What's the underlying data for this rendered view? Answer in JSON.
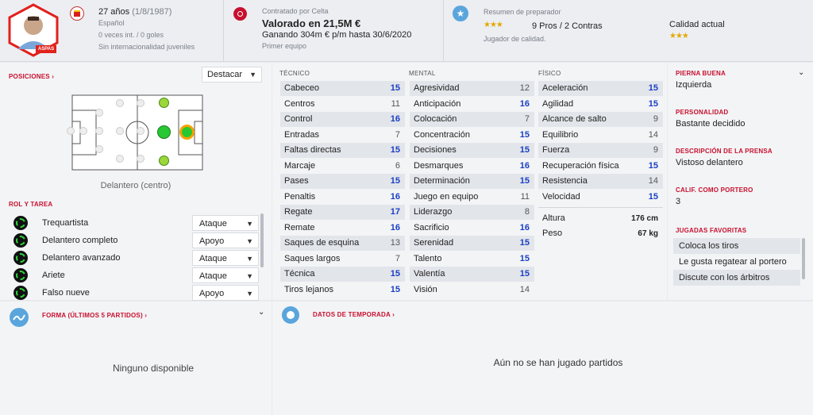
{
  "header": {
    "age": "27 años",
    "dob": "(1/8/1987)",
    "nationality": "Español",
    "caps": "0 veces int. / 0 goles",
    "youth_caps": "Sin internacionalidad juveniles",
    "player_tag": "ASPAS",
    "contract_label": "Contratado por Celta",
    "value": "Valorado en 21,5M €",
    "wage": "Ganando 304m € p/m hasta 30/6/2020",
    "squad_status": "Primer equipo",
    "scout_title": "Resumen de preparador",
    "pros_cons": "9 Pros / 2 Contras",
    "scout_summary": "Jugador de calidad.",
    "current_ability_label": "Calidad actual",
    "scout_stars": "★★★",
    "ability_stars": "★★★"
  },
  "positions": {
    "title": "POSICIONES ›",
    "dropdown": "Destacar",
    "position_label": "Delantero (centro)"
  },
  "roles": {
    "title": "ROL Y TAREA",
    "items": [
      {
        "name": "Trequartista",
        "duty": "Ataque"
      },
      {
        "name": "Delantero completo",
        "duty": "Apoyo"
      },
      {
        "name": "Delantero avanzado",
        "duty": "Ataque"
      },
      {
        "name": "Ariete",
        "duty": "Ataque"
      },
      {
        "name": "Falso nueve",
        "duty": "Apoyo"
      }
    ]
  },
  "attributes": {
    "technical_title": "TÉCNICO",
    "mental_title": "MENTAL",
    "physical_title": "FÍSICO",
    "technical": [
      {
        "name": "Cabeceo",
        "value": "15"
      },
      {
        "name": "Centros",
        "value": "11"
      },
      {
        "name": "Control",
        "value": "16"
      },
      {
        "name": "Entradas",
        "value": "7"
      },
      {
        "name": "Faltas directas",
        "value": "15"
      },
      {
        "name": "Marcaje",
        "value": "6"
      },
      {
        "name": "Pases",
        "value": "15"
      },
      {
        "name": "Penaltis",
        "value": "16"
      },
      {
        "name": "Regate",
        "value": "17"
      },
      {
        "name": "Remate",
        "value": "16"
      },
      {
        "name": "Saques de esquina",
        "value": "13"
      },
      {
        "name": "Saques largos",
        "value": "7"
      },
      {
        "name": "Técnica",
        "value": "15"
      },
      {
        "name": "Tiros lejanos",
        "value": "15"
      }
    ],
    "mental": [
      {
        "name": "Agresividad",
        "value": "12"
      },
      {
        "name": "Anticipación",
        "value": "16"
      },
      {
        "name": "Colocación",
        "value": "7"
      },
      {
        "name": "Concentración",
        "value": "15"
      },
      {
        "name": "Decisiones",
        "value": "15"
      },
      {
        "name": "Desmarques",
        "value": "16"
      },
      {
        "name": "Determinación",
        "value": "15"
      },
      {
        "name": "Juego en equipo",
        "value": "11"
      },
      {
        "name": "Liderazgo",
        "value": "8"
      },
      {
        "name": "Sacrificio",
        "value": "16"
      },
      {
        "name": "Serenidad",
        "value": "15"
      },
      {
        "name": "Talento",
        "value": "15"
      },
      {
        "name": "Valentía",
        "value": "15"
      },
      {
        "name": "Visión",
        "value": "14"
      }
    ],
    "physical": [
      {
        "name": "Aceleración",
        "value": "15"
      },
      {
        "name": "Agilidad",
        "value": "15"
      },
      {
        "name": "Alcance de salto",
        "value": "9"
      },
      {
        "name": "Equilibrio",
        "value": "14"
      },
      {
        "name": "Fuerza",
        "value": "9"
      },
      {
        "name": "Recuperación física",
        "value": "15"
      },
      {
        "name": "Resistencia",
        "value": "14"
      },
      {
        "name": "Velocidad",
        "value": "15"
      }
    ],
    "height_label": "Altura",
    "height_value": "176 cm",
    "weight_label": "Peso",
    "weight_value": "67 kg"
  },
  "sidebar": {
    "foot_label": "PIERNA BUENA",
    "foot_value": "Izquierda",
    "personality_label": "PERSONALIDAD",
    "personality_value": "Bastante decidido",
    "press_label": "DESCRIPCIÓN DE LA PRENSA",
    "press_value": "Vistoso delantero",
    "gk_label": "CALIF. COMO PORTERO",
    "gk_value": "3",
    "moves_label": "JUGADAS FAVORITAS",
    "moves": [
      "Coloca los tiros",
      "Le gusta regatear al portero",
      "Discute con los árbitros"
    ]
  },
  "form": {
    "title": "FORMA (ÚLTIMOS 5 PARTIDOS) ›",
    "empty": "Ninguno disponible"
  },
  "season": {
    "title": "DATOS DE TEMPORADA ›",
    "empty": "Aún no se han jugado partidos"
  },
  "colors": {
    "accent_red": "#c8102e",
    "value_blue": "#1a3fc4",
    "pitch_green": "#2fd33a"
  }
}
